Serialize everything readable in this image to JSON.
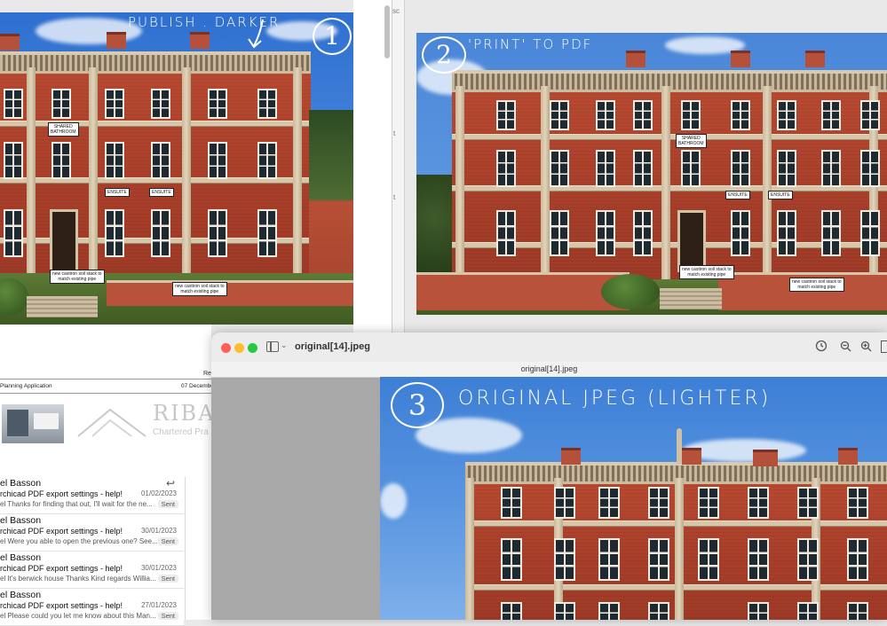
{
  "panel1": {
    "note": "PUBLISH . DARKER .",
    "number": "1",
    "labels": {
      "shared": "SHARED\nBATHROOM",
      "ensuite_a": "ENSUITE",
      "ensuite_b": "ENSUITE",
      "soil_a": "new castiron soil stack to\nmatch existing pipe",
      "soil_b": "new castiron soil stack to\nmatch existing pipe"
    }
  },
  "panel2": {
    "note": "'PRINT' TO PDF",
    "number": "2",
    "labels": {
      "shared": "SHARED\nBATHROOM",
      "ensuite_a": "ENSUITE",
      "ensuite_b": "ENSUITE",
      "soil_a": "new castiron soil stack to\nmatch existing pipe",
      "soil_b": "new castiron soil stack to\nmatch existing pipe"
    }
  },
  "middle_strip": {
    "text1": "sc",
    "text2": "t",
    "text3": "t"
  },
  "doc": {
    "left_text": "Planning Application",
    "right_text": "07 December",
    "rev": "Rev",
    "riba": "RIBA",
    "riba_sub": "Chartered Pra"
  },
  "preview": {
    "filename": "original[14].jpeg",
    "subtitle": "original[14].jpeg",
    "note": "ORIGINAL JPEG (LIGHTER)",
    "number": "3"
  },
  "mail": {
    "items": [
      {
        "from": "el Basson",
        "subject": "rchicad PDF export settings - help!",
        "date": "01/02/2023",
        "preview": "el Thanks for finding that out, I'll wait for the ne...",
        "badge": "Sent",
        "replied": true
      },
      {
        "from": "el Basson",
        "subject": "rchicad PDF export settings - help!",
        "date": "30/01/2023",
        "preview": "el Were you able to open the previous one? See...",
        "badge": "Sent",
        "replied": false
      },
      {
        "from": "el Basson",
        "subject": "rchicad PDF export settings - help!",
        "date": "30/01/2023",
        "preview": "el It's berwick house Thanks Kind regards Willia...",
        "badge": "Sent",
        "replied": false
      },
      {
        "from": "el Basson",
        "subject": "rchicad PDF export settings - help!",
        "date": "27/01/2023",
        "preview": "el Please could you let me know about this Man...",
        "badge": "Sent",
        "replied": false
      }
    ]
  },
  "colors": {
    "sky1": "#3d7fd6",
    "sky2": "#5c97e0",
    "sky3": "#4a86d8",
    "brick": "#b04530"
  }
}
